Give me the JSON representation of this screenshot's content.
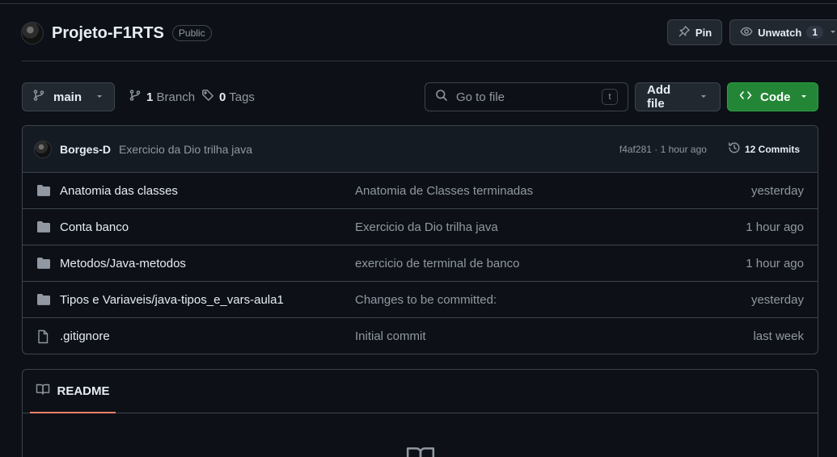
{
  "repo": {
    "name": "Projeto-F1RTS",
    "visibility": "Public",
    "pin_label": "Pin",
    "watch_label": "Unwatch",
    "watch_count": "1"
  },
  "toolbar": {
    "branch": "main",
    "branch_count": "1",
    "branch_label": "Branch",
    "tag_count": "0",
    "tag_label": "Tags",
    "goto_placeholder": "Go to file",
    "goto_shortcut": "t",
    "add_file_label": "Add file",
    "code_label": "Code"
  },
  "latest_commit": {
    "author": "Borges-D",
    "message": "Exercicio da Dio trilha java",
    "hash_time": "f4af281 · 1 hour ago",
    "commits_count": "12 Commits"
  },
  "files": [
    {
      "name": "Anatomia das classes",
      "type": "folder",
      "message": "Anatomia de Classes terminadas",
      "when": "yesterday"
    },
    {
      "name": "Conta banco",
      "type": "folder",
      "message": "Exercicio da Dio trilha java",
      "when": "1 hour ago"
    },
    {
      "name": "Metodos/Java-metodos",
      "type": "folder",
      "message": "exercicio de terminal de banco",
      "when": "1 hour ago"
    },
    {
      "name": "Tipos e Variaveis/java-tipos_e_vars-aula1",
      "type": "folder",
      "message": "Changes to be committed:",
      "when": "yesterday"
    },
    {
      "name": ".gitignore",
      "type": "file",
      "message": "Initial commit",
      "when": "last week"
    }
  ],
  "readme": {
    "tab_label": "README"
  },
  "colors": {
    "background": "#0d1117",
    "code_button": "#238636",
    "tab_underline": "#f78166"
  }
}
